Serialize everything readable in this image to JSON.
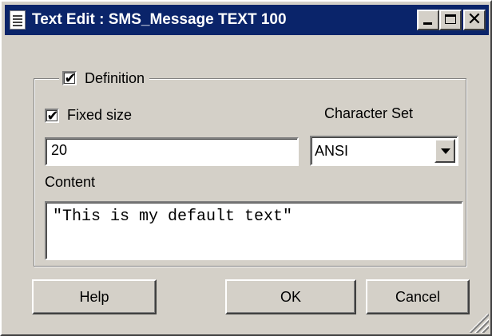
{
  "window": {
    "title": "Text Edit : SMS_Message TEXT 100",
    "icons": {
      "app": "text-document-icon",
      "minimize": "minimize-icon",
      "maximize": "maximize-icon",
      "close": "close-icon"
    }
  },
  "definition": {
    "label": "Definition",
    "checked": true
  },
  "fixed_size": {
    "label": "Fixed size",
    "checked": true,
    "value": "20"
  },
  "character_set": {
    "label": "Character Set",
    "selected": "ANSI"
  },
  "content": {
    "label": "Content",
    "value": "\"This is my default text\""
  },
  "buttons": {
    "help": "Help",
    "ok": "OK",
    "cancel": "Cancel"
  },
  "checkmark": "✔",
  "close_glyph": "✕"
}
